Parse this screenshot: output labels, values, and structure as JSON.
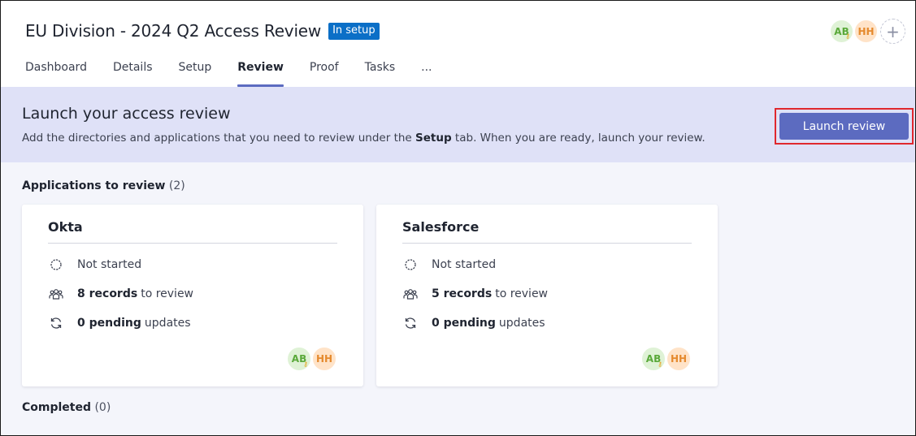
{
  "header": {
    "title": "EU Division - 2024 Q2 Access Review",
    "status_badge": "In setup",
    "avatars": [
      {
        "initials": "AB",
        "color": "#5aa93a"
      },
      {
        "initials": "HH",
        "color": "#e58a2e"
      }
    ],
    "add_symbol": "+"
  },
  "tabs": [
    {
      "label": "Dashboard",
      "active": false
    },
    {
      "label": "Details",
      "active": false
    },
    {
      "label": "Setup",
      "active": false
    },
    {
      "label": "Review",
      "active": true
    },
    {
      "label": "Proof",
      "active": false
    },
    {
      "label": "Tasks",
      "active": false
    },
    {
      "label": "...",
      "active": false
    }
  ],
  "banner": {
    "title": "Launch your access review",
    "text_before": "Add the directories and applications that you need to review under the ",
    "text_bold": "Setup",
    "text_after": " tab. When you are ready, launch your review.",
    "button_label": "Launch review"
  },
  "applications": {
    "label": "Applications to review",
    "count": "(2)",
    "cards": [
      {
        "name": "Okta",
        "status": "Not started",
        "records_bold": "8 records",
        "records_rest": "to review",
        "pending_bold": "0 pending",
        "pending_rest": "updates",
        "avatars": [
          "AB",
          "HH"
        ]
      },
      {
        "name": "Salesforce",
        "status": "Not started",
        "records_bold": "5 records",
        "records_rest": "to review",
        "pending_bold": "0 pending",
        "pending_rest": "updates",
        "avatars": [
          "AB",
          "HH"
        ]
      }
    ]
  },
  "completed": {
    "label": "Completed",
    "count": "(0)"
  },
  "colors": {
    "accent": "#5c6bc0",
    "badge": "#0b6fc7",
    "banner_bg": "#dfe1f7",
    "highlight": "#e0282e"
  }
}
